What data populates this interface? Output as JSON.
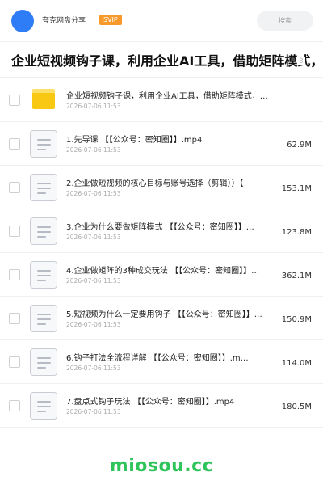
{
  "header": {
    "sharer_name": "夸克网盘分享",
    "badge": "SVIP",
    "search_placeholder": "搜索"
  },
  "folder_title": "企业短视频钩子课，利用企业AI工具，借助矩阵模式，实现",
  "folder_title_overflow": "3",
  "files": [
    {
      "type": "folder",
      "name": "企业短视频钩子课，利用企业AI工具，借助矩阵模式，…",
      "date": "2026-07-06 11:53",
      "size": ""
    },
    {
      "type": "video",
      "name": "1.先导课 【【公众号：密知圈】】.mp4",
      "date": "2026-07-06 11:53",
      "size": "62.9M"
    },
    {
      "type": "video",
      "name": "2.企业做短视频的核心目标与账号选择（剪辑））【",
      "date": "2026-07-06 11:53",
      "size": "153.1M"
    },
    {
      "type": "video",
      "name": "3.企业为什么要做矩阵模式 【【公众号：密知圈】】…",
      "date": "2026-07-06 11:53",
      "size": "123.8M"
    },
    {
      "type": "video",
      "name": "4.企业做矩阵的3种成交玩法 【【公众号：密知圈】】…",
      "date": "2026-07-06 11:53",
      "size": "362.1M"
    },
    {
      "type": "video",
      "name": "5.短视频为什么一定要用钩子 【【公众号：密知圈】】…",
      "date": "2026-07-06 11:53",
      "size": "150.9M"
    },
    {
      "type": "video",
      "name": "6.钩子打法全流程详解 【【公众号：密知圈】】.m…",
      "date": "2026-07-06 11:53",
      "size": "114.0M"
    },
    {
      "type": "video",
      "name": "7.盘点式钩子玩法 【【公众号：密知圈】】.mp4",
      "date": "2026-07-06 11:53",
      "size": "180.5M"
    }
  ],
  "watermark": "miosou.cc",
  "colors": {
    "accent": "#2f7df6",
    "badge": "#f79a2b",
    "watermark": "#2ec45a",
    "folder": "#f9c813"
  }
}
